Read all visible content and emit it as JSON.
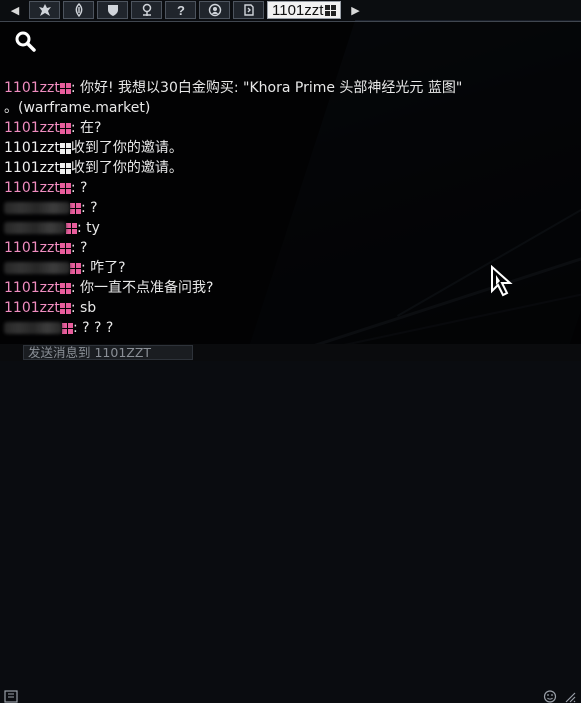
{
  "tabs": {
    "icons": [
      "clan-emblem-icon",
      "alliance-emblem-icon",
      "shield-icon",
      "location-pin-icon",
      "help-question-icon",
      "trade-icon",
      "recruit-icon"
    ],
    "active_tab_label": "1101zzt"
  },
  "chat": {
    "messages": [
      {
        "sender": "1101zzt",
        "sender_color": "pink",
        "text": "你好! 我想以30白金购买: \"Khora Prime 头部神经光元 蓝图\""
      },
      {
        "sender": "",
        "text": "。(warframe.market)"
      },
      {
        "sender": "1101zzt",
        "sender_color": "pink",
        "text": "在?"
      },
      {
        "sender": "1101zzt",
        "sender_color": "white",
        "text": " 收到了你的邀请。"
      },
      {
        "sender": "1101zzt",
        "sender_color": "white",
        "text": " 收到了你的邀请。"
      },
      {
        "sender": "1101zzt",
        "sender_color": "pink",
        "text": "?"
      },
      {
        "sender": "redacted",
        "text": "?"
      },
      {
        "sender": "redacted",
        "text": "ty"
      },
      {
        "sender": "1101zzt",
        "sender_color": "pink",
        "text": "?"
      },
      {
        "sender": "redacted",
        "text": "咋了?"
      },
      {
        "sender": "1101zzt",
        "sender_color": "pink",
        "text": "你一直不点准备问我?"
      },
      {
        "sender": "1101zzt",
        "sender_color": "pink",
        "text": "sb"
      },
      {
        "sender": "redacted",
        "text": "? ? ?"
      }
    ]
  },
  "input": {
    "placeholder": "发送消息到 1101ZZT"
  },
  "colors": {
    "sender_pink": "#f08dc0",
    "windows_icon": "#e85d9c",
    "chat_bg": "#000000"
  }
}
